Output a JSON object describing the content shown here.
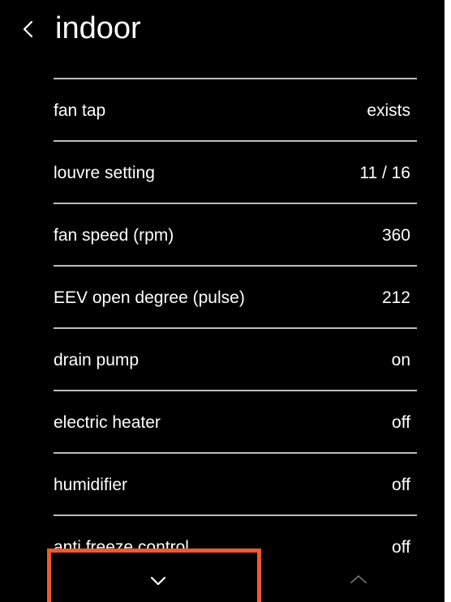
{
  "header": {
    "back_icon": "chevron-left-icon",
    "title": "indoor"
  },
  "list": {
    "items": [
      {
        "label": "fan tap",
        "value": "exists"
      },
      {
        "label": "louvre setting",
        "value": "11 / 16"
      },
      {
        "label": "fan speed (rpm)",
        "value": "360"
      },
      {
        "label": "EEV open degree (pulse)",
        "value": "212"
      },
      {
        "label": "drain pump",
        "value": "on"
      },
      {
        "label": "electric heater",
        "value": "off"
      },
      {
        "label": "humidifier",
        "value": "off"
      },
      {
        "label": "anti freeze control",
        "value": "off"
      }
    ]
  },
  "footer": {
    "scroll_down_icon": "chevron-down-icon",
    "scroll_up_icon": "chevron-up-icon"
  },
  "colors": {
    "background": "#000000",
    "text": "#ffffff",
    "divider": "#bdbdbd",
    "highlight": "#ee5a2f",
    "disabled_icon": "#6f6f6f"
  }
}
